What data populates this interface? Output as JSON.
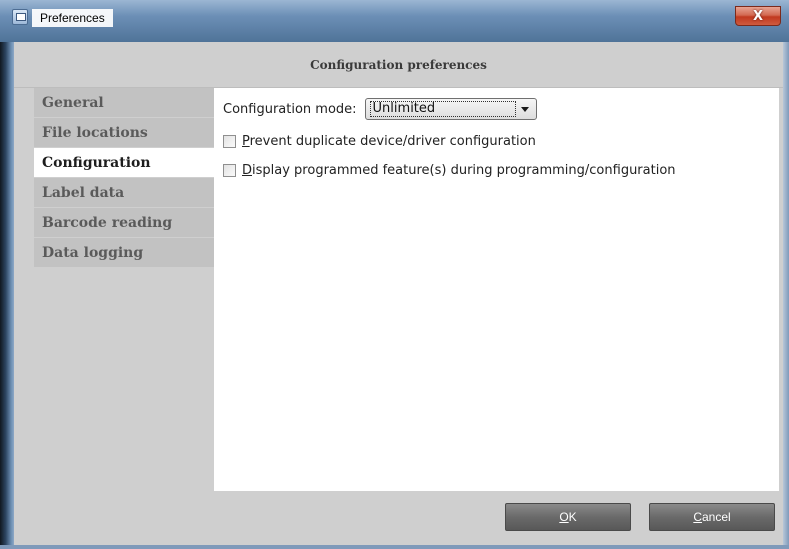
{
  "window": {
    "title": "Preferences",
    "close_glyph": "X"
  },
  "header": {
    "title": "Configuration preferences"
  },
  "sidebar": {
    "items": [
      {
        "label": "General",
        "active": false
      },
      {
        "label": "File locations",
        "active": false
      },
      {
        "label": "Configuration",
        "active": true
      },
      {
        "label": "Label data",
        "active": false
      },
      {
        "label": "Barcode reading",
        "active": false
      },
      {
        "label": "Data logging",
        "active": false
      }
    ]
  },
  "configuration": {
    "mode_label": "Configuration mode:",
    "mode_value": "Unlimited",
    "checkboxes": [
      {
        "mnemonic": "P",
        "rest": "revent duplicate device/driver configuration",
        "checked": false
      },
      {
        "mnemonic": "D",
        "rest": "isplay programmed feature(s) during programming/configuration",
        "checked": false
      }
    ]
  },
  "buttons": {
    "ok": {
      "mnemonic": "O",
      "rest": "K"
    },
    "cancel": {
      "mnemonic": "C",
      "rest": "ancel"
    }
  },
  "icons": {
    "app": "app-window-icon",
    "close": "close-icon",
    "dropdown": "chevron-down-icon"
  }
}
